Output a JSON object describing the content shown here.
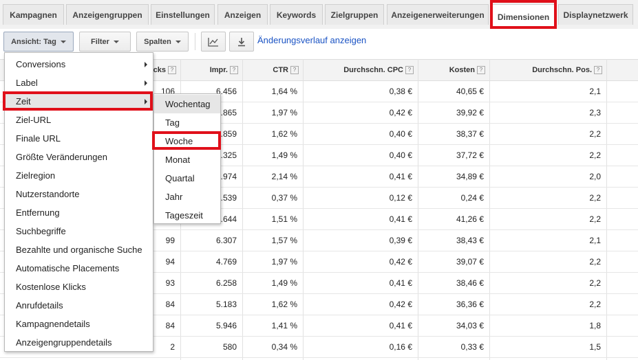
{
  "tabs": [
    "Kampagnen",
    "Anzeigengruppen",
    "Einstellungen",
    "Anzeigen",
    "Keywords",
    "Zielgruppen",
    "Anzeigenerweiterungen",
    "Dimensionen",
    "Displaynetzwerk"
  ],
  "toolbar": {
    "view_label": "Ansicht: Tag",
    "filter_label": "Filter",
    "columns_label": "Spalten",
    "chart_icon": "line-chart-icon",
    "download_icon": "download-icon",
    "history_link": "Änderungsverlauf anzeigen"
  },
  "table": {
    "headers": {
      "clicks": "cks",
      "impr": "Impr.",
      "ctr": "CTR",
      "cpc": "Durchschn. CPC",
      "cost": "Kosten",
      "pos": "Durchschn. Pos."
    },
    "help_mark": "?",
    "rows": [
      {
        "clicks": "106",
        "impr": "6.456",
        "ctr": "1,64 %",
        "cpc": "0,38 €",
        "cost": "40,65 €",
        "pos": "2,1"
      },
      {
        "clicks": "",
        "impr": ".865",
        "ctr": "1,97 %",
        "cpc": "0,42 €",
        "cost": "39,92 €",
        "pos": "2,3"
      },
      {
        "clicks": "",
        "impr": ".859",
        "ctr": "1,62 %",
        "cpc": "0,40 €",
        "cost": "38,37 €",
        "pos": "2,2"
      },
      {
        "clicks": "",
        "impr": ".325",
        "ctr": "1,49 %",
        "cpc": "0,40 €",
        "cost": "37,72 €",
        "pos": "2,2"
      },
      {
        "clicks": "",
        "impr": ".974",
        "ctr": "2,14 %",
        "cpc": "0,41 €",
        "cost": "34,89 €",
        "pos": "2,0"
      },
      {
        "clicks": "",
        "impr": ".539",
        "ctr": "0,37 %",
        "cpc": "0,12 €",
        "cost": "0,24 €",
        "pos": "2,2"
      },
      {
        "clicks": "",
        "impr": ".644",
        "ctr": "1,51 %",
        "cpc": "0,41 €",
        "cost": "41,26 €",
        "pos": "2,2"
      },
      {
        "clicks": "99",
        "impr": "6.307",
        "ctr": "1,57 %",
        "cpc": "0,39 €",
        "cost": "38,43 €",
        "pos": "2,1"
      },
      {
        "clicks": "94",
        "impr": "4.769",
        "ctr": "1,97 %",
        "cpc": "0,42 €",
        "cost": "39,07 €",
        "pos": "2,2"
      },
      {
        "clicks": "93",
        "impr": "6.258",
        "ctr": "1,49 %",
        "cpc": "0,41 €",
        "cost": "38,46 €",
        "pos": "2,2"
      },
      {
        "clicks": "84",
        "impr": "5.183",
        "ctr": "1,62 %",
        "cpc": "0,42 €",
        "cost": "36,36 €",
        "pos": "2,2"
      },
      {
        "clicks": "84",
        "impr": "5.946",
        "ctr": "1,41 %",
        "cpc": "0,41 €",
        "cost": "34,03 €",
        "pos": "1,8"
      },
      {
        "clicks": "2",
        "impr": "580",
        "ctr": "0,34 %",
        "cpc": "0,16 €",
        "cost": "0,33 €",
        "pos": "1,5"
      }
    ]
  },
  "menu": {
    "items": [
      {
        "label": "Conversions",
        "submenu": true
      },
      {
        "label": "Label",
        "submenu": true
      },
      {
        "label": "Zeit",
        "submenu": true
      },
      {
        "label": "Ziel-URL",
        "submenu": false
      },
      {
        "label": "Finale URL",
        "submenu": false
      },
      {
        "label": "Größte Veränderungen",
        "submenu": false
      },
      {
        "label": "Zielregion",
        "submenu": false
      },
      {
        "label": "Nutzerstandorte",
        "submenu": false
      },
      {
        "label": "Entfernung",
        "submenu": false
      },
      {
        "label": "Suchbegriffe",
        "submenu": false
      },
      {
        "label": "Bezahlte und organische Suche",
        "submenu": false
      },
      {
        "label": "Automatische Placements",
        "submenu": false
      },
      {
        "label": "Kostenlose Klicks",
        "submenu": false
      },
      {
        "label": "Anrufdetails",
        "submenu": false
      },
      {
        "label": "Kampagnendetails",
        "submenu": false
      },
      {
        "label": "Anzeigengruppendetails",
        "submenu": false
      }
    ],
    "selected_index": 2
  },
  "submenu": {
    "items": [
      "Wochentag",
      "Tag",
      "Woche",
      "Monat",
      "Quartal",
      "Jahr",
      "Tageszeit"
    ],
    "hover_index": 0
  },
  "colors": {
    "highlight": "#e0101a",
    "link": "#1a53c4"
  }
}
